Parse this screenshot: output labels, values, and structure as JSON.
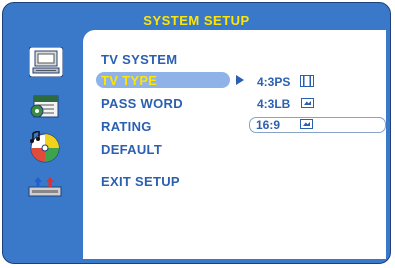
{
  "title": "SYSTEM SETUP",
  "menu": {
    "tv_system": "TV SYSTEM",
    "tv_type": "TV TYPE",
    "pass_word": "PASS WORD",
    "rating": "RATING",
    "default": "DEFAULT",
    "exit_setup": "EXIT SETUP"
  },
  "tv_type_options": {
    "opt1": "4:3PS",
    "opt2": "4:3LB",
    "opt3": "16:9"
  },
  "sidebar": {
    "icons": [
      "computer-monitor-icon",
      "settings-calendar-icon",
      "music-disc-icon",
      "speaker-arrows-icon"
    ]
  },
  "colors": {
    "background": "#3a78c9",
    "title": "#ffe600",
    "menu_text": "#2b5fb0",
    "highlight": "#8fb2e8"
  }
}
